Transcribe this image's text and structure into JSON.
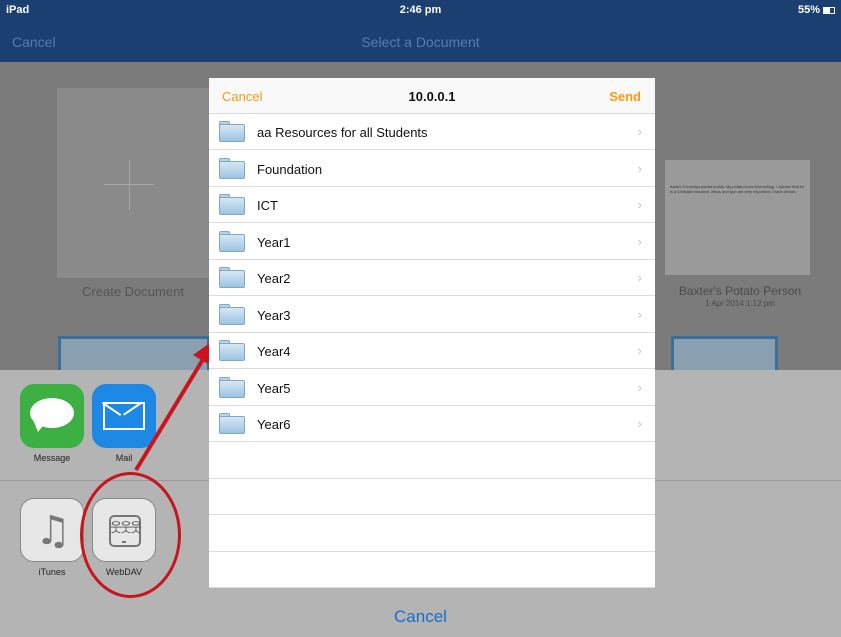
{
  "status_bar": {
    "device": "iPad",
    "time": "2:46 pm",
    "battery": "55%"
  },
  "nav_bar": {
    "cancel_label": "Cancel",
    "title": "Select a Document"
  },
  "background": {
    "create_document_label": "Create Document",
    "potato_doc": {
      "preview_text": "baxter Considiya potato buddy. My potato loves technology. I Admire that he is a Christian because Jesus and god are very important. I have shown",
      "title": "Baxter's Potato Person",
      "date": "1 Apr 2014 1:12 pm"
    }
  },
  "popup": {
    "cancel_label": "Cancel",
    "title": "10.0.0.1",
    "send_label": "Send",
    "folders": [
      "aa Resources for all Students",
      "Foundation",
      "ICT",
      "Year1",
      "Year2",
      "Year3",
      "Year4",
      "Year5",
      "Year6"
    ],
    "chevron": "›"
  },
  "share_sheet": {
    "row1": [
      {
        "label": "Message",
        "icon": "message-icon",
        "color": "#3cb043"
      },
      {
        "label": "Mail",
        "icon": "mail-icon",
        "color": "#1e88e5"
      }
    ],
    "row2": [
      {
        "label": "iTunes",
        "icon": "music-note-icon"
      },
      {
        "label": "WebDAV",
        "icon": "network-drive-icon"
      }
    ],
    "cancel_label": "Cancel"
  },
  "colors": {
    "accent_orange": "#f39c12",
    "nav_blue": "#1c3f72",
    "annotation_red": "#c8141c",
    "link_blue": "#1570c9"
  }
}
